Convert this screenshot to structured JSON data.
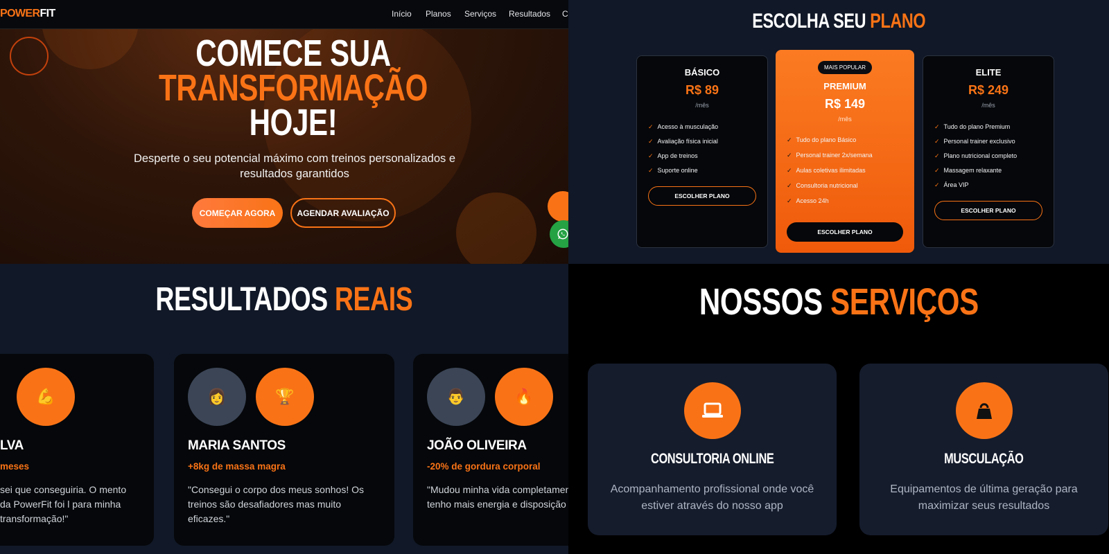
{
  "hero": {
    "logo": {
      "part1": "POWER",
      "part2": "FIT"
    },
    "nav": [
      "Início",
      "Planos",
      "Serviços",
      "Resultados",
      "Co"
    ],
    "headline": {
      "line1": "COMECE SUA",
      "line2": "TRANSFORMAÇÃO",
      "line3": "HOJE!"
    },
    "subtitle": "Desperte o seu potencial máximo com treinos personalizados e resultados garantidos",
    "cta_primary": "COMEÇAR AGORA",
    "cta_secondary": "AGENDAR AVALIAÇÃO"
  },
  "plans": {
    "title": {
      "white": "ESCOLHA SEU",
      "orange": "PLANO"
    },
    "items": [
      {
        "name": "BÁSICO",
        "price": "R$ 89",
        "period": "/mês",
        "features": [
          "Acesso à musculação",
          "Avaliação física inicial",
          "App de treinos",
          "Suporte online"
        ],
        "button": "ESCOLHER PLANO"
      },
      {
        "badge": "MAIS POPULAR",
        "name": "PREMIUM",
        "price": "R$ 149",
        "period": "/mês",
        "features": [
          "Tudo do plano Básico",
          "Personal trainer 2x/semana",
          "Aulas coletivas ilimitadas",
          "Consultoria nutricional",
          "Acesso 24h"
        ],
        "button": "ESCOLHER PLANO"
      },
      {
        "name": "ELITE",
        "price": "R$ 249",
        "period": "/mês",
        "features": [
          "Tudo do plano Premium",
          "Personal trainer exclusivo",
          "Plano nutricional completo",
          "Massagem relaxante",
          "Área VIP"
        ],
        "button": "ESCOLHER PLANO"
      }
    ]
  },
  "results": {
    "title": {
      "white": "RESULTADOS",
      "orange": "REAIS"
    },
    "cards": [
      {
        "avatar2": "💪",
        "name": "LVA",
        "result": "meses",
        "quote": "sei que conseguiria. O mento da PowerFit foi l para minha transformação!\""
      },
      {
        "avatar1": "👩",
        "avatar2": "🏆",
        "name": "MARIA SANTOS",
        "result": "+8kg de massa magra",
        "quote": "\"Consegui o corpo dos meus sonhos! Os treinos são desafiadores mas muito eficazes.\""
      },
      {
        "avatar1": "👨",
        "avatar2": "🔥",
        "name": "JOÃO OLIVEIRA",
        "result": "-20% de gordura corporal",
        "quote": "\"Mudou minha vida completamen tenho mais energia e disposição"
      }
    ]
  },
  "services": {
    "title": {
      "white": "NOSSOS",
      "orange": "SERVIÇOS"
    },
    "cards": [
      {
        "icon": "laptop-icon",
        "title": "CONSULTORIA ONLINE",
        "desc": "Acompanhamento profissional onde você estiver através do nosso app"
      },
      {
        "icon": "kettlebell-icon",
        "title": "MUSCULAÇÃO",
        "desc": "Equipamentos de última geração para maximizar seus resultados"
      }
    ]
  },
  "colors": {
    "accent": "#f97316",
    "dark": "#05070a",
    "navy": "#111827",
    "whatsapp": "#25a244"
  }
}
